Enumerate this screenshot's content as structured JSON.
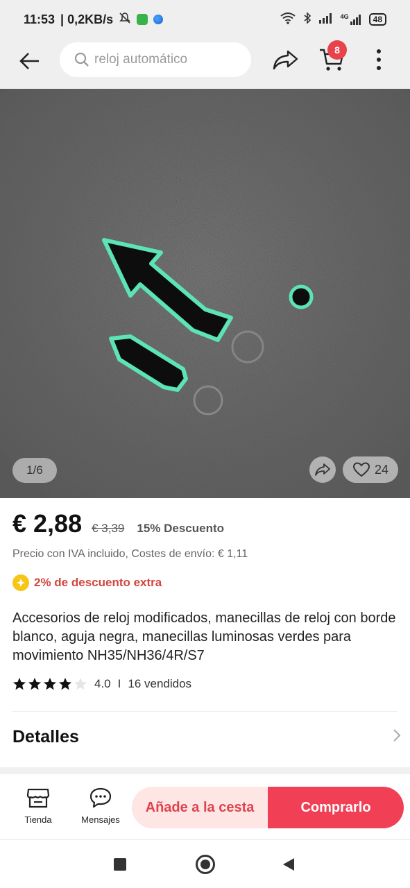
{
  "status_bar": {
    "time": "11:53",
    "speed": "| 0,2KB/s",
    "battery": "48",
    "network_label": "4G"
  },
  "header": {
    "search_placeholder": "reloj automático",
    "cart_count": "8"
  },
  "gallery": {
    "counter": "1/6",
    "likes": "24"
  },
  "price": {
    "current": "€ 2,88",
    "original": "€ 3,39",
    "discount": "15% Descuento",
    "vat_shipping": "Precio con IVA incluido, Costes de envío: € 1,11",
    "extra_discount": "2% de descuento extra"
  },
  "product": {
    "title": "Accesorios de reloj modificados, manecillas de reloj con borde blanco, aguja negra, manecillas luminosas verdes para movimiento NH35/NH36/4R/S7",
    "rating": "4.0",
    "rating_stars": 4,
    "separator": "I",
    "sold": "16 vendidos"
  },
  "details": {
    "title": "Detalles"
  },
  "actions": {
    "store": "Tienda",
    "messages": "Mensajes",
    "add_to_cart": "Añade a la cesta",
    "buy": "Comprarlo"
  },
  "colors": {
    "accent": "#f13f55",
    "accent_light": "#fde6e4",
    "badge": "#e8434a",
    "lume": "#5de3b8"
  }
}
